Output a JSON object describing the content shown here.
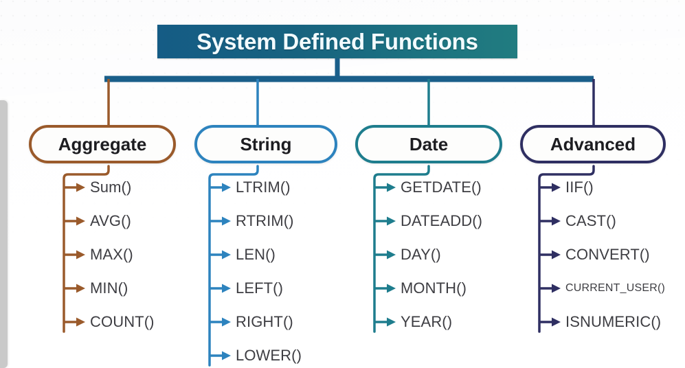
{
  "title": {
    "text": "System Defined Functions",
    "bg_gradient_from": "#155c85",
    "bg_gradient_to": "#217c80",
    "text_color": "#f2fbff"
  },
  "root_connector_color": "#1a5f8a",
  "categories": [
    {
      "label": "Aggregate",
      "color": "#9a5a2b",
      "functions": [
        {
          "name": "Sum()",
          "size": "normal"
        },
        {
          "name": "AVG()",
          "size": "normal"
        },
        {
          "name": "MAX()",
          "size": "normal"
        },
        {
          "name": "MIN()",
          "size": "normal"
        },
        {
          "name": "COUNT()",
          "size": "normal"
        }
      ]
    },
    {
      "label": "String",
      "color": "#2d83be",
      "functions": [
        {
          "name": "LTRIM()",
          "size": "normal"
        },
        {
          "name": "RTRIM()",
          "size": "normal"
        },
        {
          "name": "LEN()",
          "size": "normal"
        },
        {
          "name": "LEFT()",
          "size": "normal"
        },
        {
          "name": "RIGHT()",
          "size": "normal"
        },
        {
          "name": "LOWER()",
          "size": "normal"
        }
      ]
    },
    {
      "label": "Date",
      "color": "#1e7d8d",
      "functions": [
        {
          "name": "GETDATE()",
          "size": "normal"
        },
        {
          "name": "DATEADD()",
          "size": "normal"
        },
        {
          "name": "DAY()",
          "size": "normal"
        },
        {
          "name": "MONTH()",
          "size": "normal"
        },
        {
          "name": "YEAR()",
          "size": "normal"
        }
      ]
    },
    {
      "label": "Advanced",
      "color": "#2f2f62",
      "functions": [
        {
          "name": "IIF()",
          "size": "normal"
        },
        {
          "name": "CAST()",
          "size": "normal"
        },
        {
          "name": "CONVERT()",
          "size": "normal"
        },
        {
          "name": "CURRENT_USER()",
          "size": "small"
        },
        {
          "name": "ISNUMERIC()",
          "size": "normal"
        }
      ]
    }
  ]
}
